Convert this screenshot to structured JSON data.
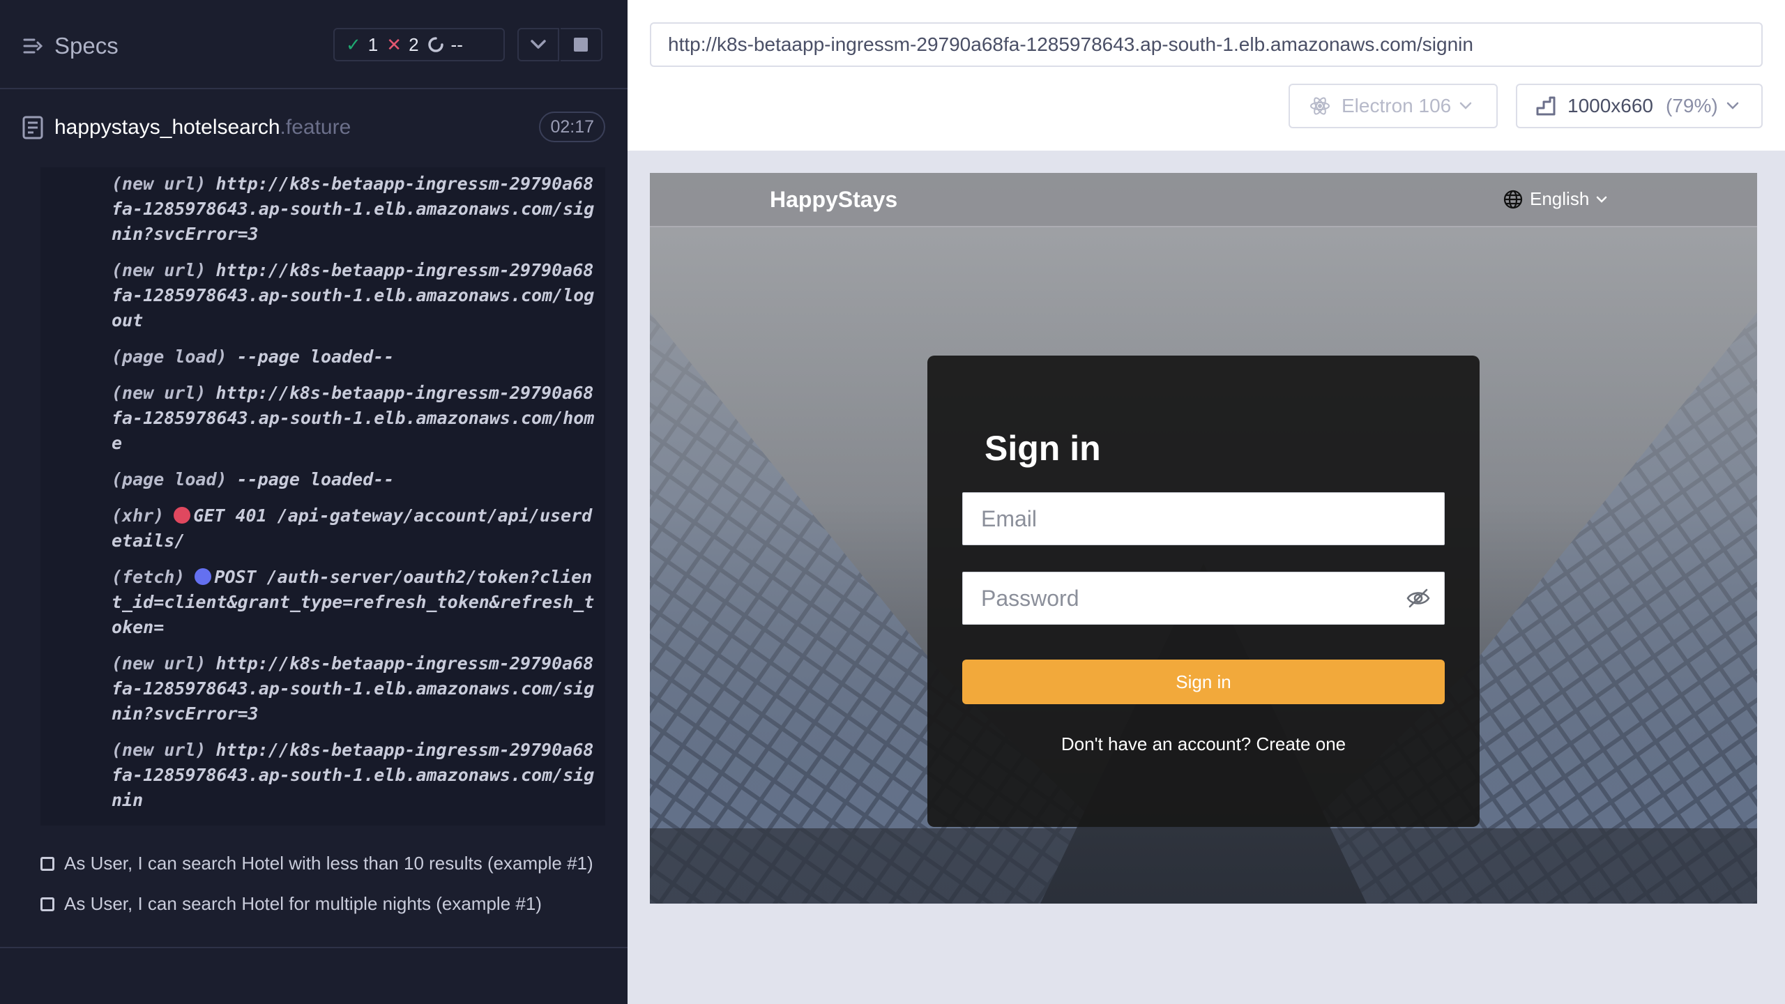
{
  "reporter": {
    "header": {
      "specs_label": "Specs",
      "passed": "1",
      "failed": "2",
      "pending": "--"
    },
    "spec_file": {
      "name": "happystays_hotelsearch",
      "extension": ".feature",
      "duration": "02:17"
    },
    "log": [
      {
        "kind": "(new url)",
        "dot": "",
        "msg": "http://k8s-betaapp-ingressm-29790a68fa-1285978643.ap-south-1.elb.amazonaws.com/signin?svcError=3"
      },
      {
        "kind": "(new url)",
        "dot": "",
        "msg": "http://k8s-betaapp-ingressm-29790a68fa-1285978643.ap-south-1.elb.amazonaws.com/logout"
      },
      {
        "kind": "(page load)",
        "dot": "",
        "msg": "--page loaded--"
      },
      {
        "kind": "(new url)",
        "dot": "",
        "msg": "http://k8s-betaapp-ingressm-29790a68fa-1285978643.ap-south-1.elb.amazonaws.com/home"
      },
      {
        "kind": "(page load)",
        "dot": "",
        "msg": "--page loaded--"
      },
      {
        "kind": "(xhr)",
        "dot": "red",
        "msg": "GET 401 /api-gateway/account/api/userdetails/"
      },
      {
        "kind": "(fetch)",
        "dot": "blue",
        "msg": "POST /auth-server/oauth2/token?client_id=client&grant_type=refresh_token&refresh_token="
      },
      {
        "kind": "(new url)",
        "dot": "",
        "msg": "http://k8s-betaapp-ingressm-29790a68fa-1285978643.ap-south-1.elb.amazonaws.com/signin?svcError=3"
      },
      {
        "kind": "(new url)",
        "dot": "",
        "msg": "http://k8s-betaapp-ingressm-29790a68fa-1285978643.ap-south-1.elb.amazonaws.com/signin"
      }
    ],
    "tests": [
      {
        "label": "As User, I can search Hotel with less than 10 results (example #1)"
      },
      {
        "label": "As User, I can search Hotel for multiple nights (example #1)"
      }
    ]
  },
  "runner": {
    "url": "http://k8s-betaapp-ingressm-29790a68fa-1285978643.ap-south-1.elb.amazonaws.com/signin",
    "browser": "Electron 106",
    "viewport": "1000x660",
    "scale": "(79%)"
  },
  "aut": {
    "brand": "HappyStays",
    "language": "English",
    "signin": {
      "title": "Sign in",
      "email_placeholder": "Email",
      "password_placeholder": "Password",
      "submit_label": "Sign in",
      "signup_text": "Don't have an account? Create one"
    }
  },
  "colors": {
    "reporter_bg": "#1b1e2e",
    "pass": "#1fa971",
    "fail": "#e45770",
    "accent_button": "#f2a93b"
  }
}
